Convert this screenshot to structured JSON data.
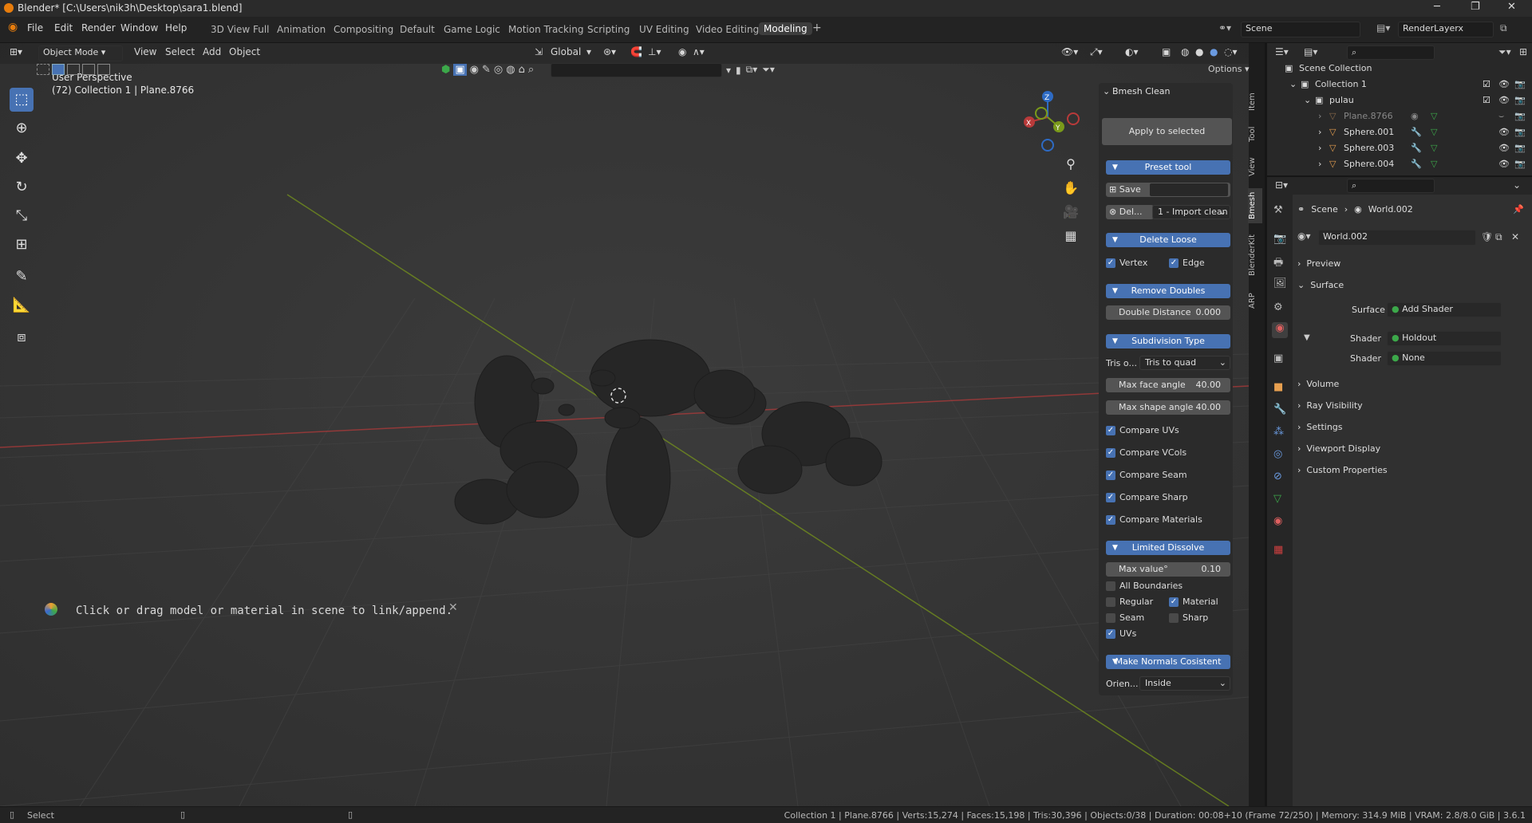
{
  "window": {
    "title": "Blender* [C:\\Users\\nik3h\\Desktop\\sara1.blend]"
  },
  "menubar": {
    "items": [
      "File",
      "Edit",
      "Render",
      "Window",
      "Help"
    ]
  },
  "workspaces": {
    "tabs": [
      "3D View Full",
      "Animation",
      "Compositing",
      "Default",
      "Game Logic",
      "Motion Tracking",
      "Scripting",
      "UV Editing",
      "Video Editing",
      "Modeling"
    ],
    "active": "Modeling"
  },
  "scene": {
    "name": "Scene",
    "view_layer": "RenderLayerx"
  },
  "viewport_header": {
    "mode": "Object Mode",
    "menus": [
      "View",
      "Select",
      "Add",
      "Object"
    ],
    "orientation": "Global",
    "options": "Options"
  },
  "viewport": {
    "perspective": "User Perspective",
    "info": "(72) Collection 1 | Plane.8766",
    "hint": "Click or drag model or material in scene to link/append.",
    "axis_labels": {
      "x": "X",
      "y": "Y",
      "z": "Z"
    }
  },
  "npanel": {
    "tabs": [
      "Item",
      "Tool",
      "View",
      "Bmesh",
      "BlenderKit",
      "ARP"
    ],
    "panel_title": "Bmesh Clean",
    "apply_label": "Apply to selected",
    "preset_label": "Preset tool",
    "save_label": "Save",
    "delete_label": "Del...",
    "preset_value": "1 - Import clean",
    "delete_loose": "Delete Loose",
    "vertex": "Vertex",
    "edge": "Edge",
    "remove_doubles": "Remove Doubles",
    "double_distance": {
      "label": "Double Distance",
      "value": "0.000"
    },
    "subdivision_type": "Subdivision Type",
    "tris_label": "Tris o...",
    "tris_value": "Tris to quad",
    "max_face_angle": {
      "label": "Max face angle",
      "value": "40.00"
    },
    "max_shape_angle": {
      "label": "Max shape angle",
      "value": "40.00"
    },
    "compare": [
      "Compare UVs",
      "Compare VCols",
      "Compare Seam",
      "Compare Sharp",
      "Compare Materials"
    ],
    "limited_dissolve": "Limited Dissolve",
    "max_value": {
      "label": "Max value°",
      "value": "0.10"
    },
    "all_boundaries": "All Boundaries",
    "regular": "Regular",
    "material": "Material",
    "seam": "Seam",
    "sharp": "Sharp",
    "uvs": "UVs",
    "normals": "Make Normals Cosistent",
    "orient_label": "Orien...",
    "orient_value": "Inside"
  },
  "outliner": {
    "root": "Scene Collection",
    "rows": [
      {
        "name": "Collection 1",
        "indent": 1
      },
      {
        "name": "pulau",
        "indent": 2
      },
      {
        "name": "Plane.8766",
        "indent": 3
      },
      {
        "name": "Sphere.001",
        "indent": 3
      },
      {
        "name": "Sphere.003",
        "indent": 3
      },
      {
        "name": "Sphere.004",
        "indent": 3
      }
    ]
  },
  "properties": {
    "breadcrumb": [
      "Scene",
      "World.002"
    ],
    "world": "World.002",
    "sections": [
      "Preview",
      "Surface",
      "Volume",
      "Ray Visibility",
      "Settings",
      "Viewport Display",
      "Custom Properties"
    ],
    "surface": {
      "label": "Surface",
      "value": "Add Shader"
    },
    "shader1": {
      "label": "Shader",
      "value": "Holdout"
    },
    "shader2": {
      "label": "Shader",
      "value": "None"
    }
  },
  "statusbar": {
    "left": "Select",
    "right": "Collection 1 | Plane.8766 | Verts:15,274 | Faces:15,198 | Tris:30,396 | Objects:0/38 | Duration: 00:08+10 (Frame 72/250) | Memory: 314.9 MiB | VRAM: 2.8/8.0 GiB | 3.6.1"
  },
  "colors": {
    "accent": "#4772b3",
    "x_axis": "#b83a3a",
    "y_axis": "#7a9a1a",
    "z_axis": "#2e6bc4",
    "object": "#e8a050"
  }
}
